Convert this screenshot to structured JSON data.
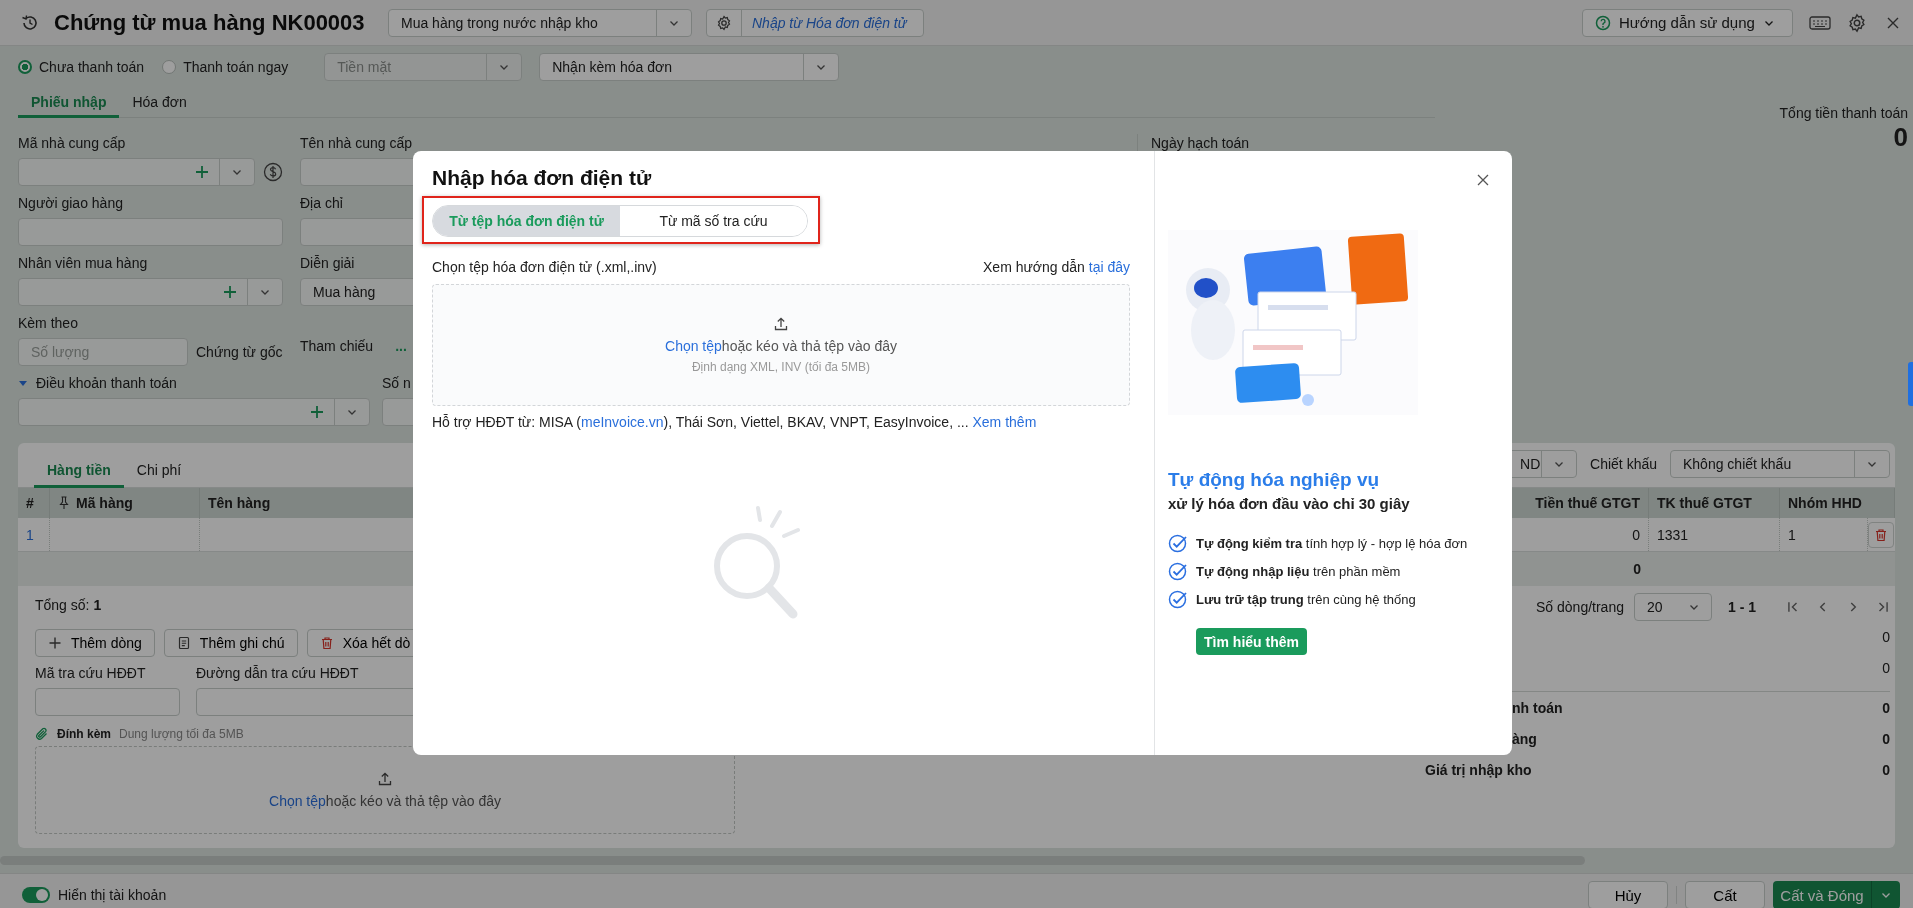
{
  "header": {
    "title": "Chứng từ mua hàng NK00003",
    "voucher_type": "Mua hàng trong nước nhập kho",
    "import_link": "Nhập từ Hóa đơn điện tử",
    "help": "Hướng dẫn sử dụng"
  },
  "payment_options": [
    {
      "label": "Chưa thanh toán",
      "selected": true
    },
    {
      "label": "Thanh toán ngay",
      "selected": false
    }
  ],
  "payment_method": {
    "value": "Tiền mặt",
    "disabled": true
  },
  "invoice_option": "Nhận kèm hóa đơn",
  "tabs": [
    {
      "label": "Phiếu nhập",
      "selected": true
    },
    {
      "label": "Hóa đơn",
      "selected": false
    }
  ],
  "total": {
    "label": "Tổng tiền thanh toán",
    "value": "0"
  },
  "form": {
    "supplier_code": "Mã nhà cung cấp",
    "supplier_name": "Tên nhà cung cấp",
    "deliverer": "Người giao hàng",
    "address": "Địa chỉ",
    "purchaser": "Nhân viên mua hàng",
    "description": {
      "label": "Diễn giải",
      "value": "Mua hàng"
    },
    "attached": {
      "label": "Kèm theo",
      "placeholder": "Số lượng",
      "unit": "Chứng từ gốc"
    },
    "reference": {
      "label": "Tham chiếu",
      "more": "..."
    },
    "payment_terms": {
      "label": "Điều khoản thanh toán",
      "expanded": true
    },
    "column_2": "Số n",
    "posting_date": "Ngày hạch toán"
  },
  "grid": {
    "tabs": [
      {
        "label": "Hàng tiền",
        "selected": true
      },
      {
        "label": "Chi phí",
        "selected": false
      }
    ],
    "currency": "ND",
    "discount_label": "Chiết khấu",
    "discount": "Không chiết khấu",
    "columns": [
      "#",
      "Mã hàng",
      "Tên hàng",
      "Tiền thuế GTGT",
      "TK thuế GTGT",
      "Nhóm HHD"
    ],
    "rows": [
      {
        "no": "1",
        "vat_amount": "0",
        "vat_account": "1331",
        "goods_group": "1"
      }
    ],
    "sum": "0",
    "count": "Tổng số: **1**",
    "page_size_label": "Số dòng/trang",
    "page_size": "20",
    "range": "1 - 1",
    "actions": [
      {
        "label": "Thêm dòng",
        "kind": "add"
      },
      {
        "label": "Thêm ghi chú",
        "kind": "note"
      },
      {
        "label": "Xóa hết dò",
        "kind": "delete"
      }
    ],
    "lookup_code": "Mã tra cứu HĐĐT",
    "lookup_url": "Đường dẫn tra cứu HĐĐT",
    "attach_label": "Đính kèm",
    "attach_hint": "Dung lượng tối đa 5MB",
    "drop_link": "Chọn tệp",
    "drop_text": "hoặc kéo và thả tệp vào đây"
  },
  "summary": [
    {
      "kind": "hidden",
      "value": "0",
      "bold": false
    },
    {
      "kind": "hidden",
      "value": "0",
      "bold": false
    },
    {
      "kind": "covered",
      "label": "nh toán",
      "value": "0",
      "bold": true
    },
    {
      "kind": "covered",
      "label": "àng",
      "value": "0",
      "bold": true
    },
    {
      "kind": "full",
      "label": "Giá trị nhập kho",
      "value": "0",
      "bold": true
    }
  ],
  "footer": {
    "show_accounts": {
      "label": "Hiển thị tài khoản",
      "on": true
    },
    "buttons": [
      {
        "label": "Hủy",
        "kind": "secondary"
      },
      {
        "label": "Cất",
        "kind": "secondary"
      },
      {
        "label": "Cất và Đóng",
        "kind": "primary"
      }
    ]
  },
  "dialog": {
    "title": "Nhập hóa đơn điện tử",
    "modes_highlighted": true,
    "modes": [
      {
        "label": "Từ tệp hóa đơn điện tử",
        "selected": true
      },
      {
        "label": "Từ mã số tra cứu",
        "selected": false
      }
    ],
    "file_label": "Chọn tệp hóa đơn điện tử (.xml,.inv)",
    "guide_text": "Xem hướng dẫn",
    "guide_link": "tại đây",
    "drop_link": "Chọn tệp",
    "drop_text": "hoặc kéo và thả tệp vào đây",
    "drop_hint": "Định dạng XML, INV (tối đa 5MB)",
    "support": {
      "before": "Hỗ trợ HĐĐT từ: MISA (",
      "link": "meInvoice.vn",
      "after": "), Thái Sơn, Viettel, BKAV, VNPT, EasyInvoice, ...",
      "more": "Xem thêm"
    },
    "promo": {
      "kind": "picture",
      "heading": "Tự động hóa nghiệp vụ",
      "subheading": "xử lý hóa đơn đầu vào chỉ 30 giây",
      "features": [
        "**Tự động kiểm tra** tính hợp lý - hợp lệ hóa đơn",
        "**Tự động nhập liệu** trên phần mềm",
        "**Lưu trữ tập trung** trên cùng hệ thống"
      ],
      "button": "Tìm hiểu thêm"
    }
  }
}
